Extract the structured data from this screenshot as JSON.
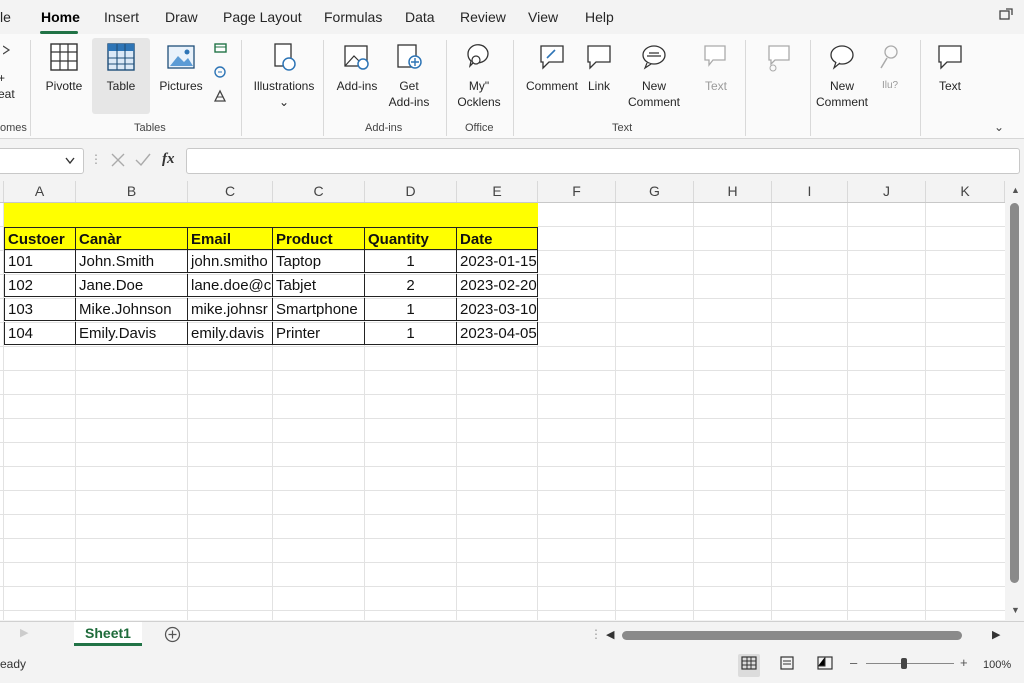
{
  "menu": {
    "file_partial": "le",
    "items": [
      "Home",
      "Insert",
      "Draw",
      "Page Layout",
      "Formulas",
      "Data",
      "Review",
      "View",
      "Help"
    ]
  },
  "ribbon": {
    "left_partial_1": "+",
    "left_partial_2": "eat",
    "left_group_partial": "omes",
    "pivot_label": "Pivotte",
    "table_label": "Table",
    "pictures_label": "Pictures",
    "tables_group": "Tables",
    "illustrations_label": "Illustrations",
    "addins_label": "Add-ins",
    "get_addins_label_1": "Get",
    "get_addins_label_2": "Add-ins",
    "addins_group": "Add-ins",
    "myoffice_label_1": "My\"",
    "myoffice_label_2": "Ocklens",
    "office_group": "Office",
    "comment_label": "Comment",
    "link_label": "Link",
    "new_comment_label_1": "New",
    "new_comment_label_2": "Comment",
    "text_dim_label": "Text",
    "text_group": "Text",
    "new_comment2_label_1": "New",
    "new_comment2_label_2": "Comment",
    "small_dim_label": "Ilu?",
    "text_label": "Text"
  },
  "formula_bar": {
    "fx": "fx",
    "value": ""
  },
  "columns": [
    "A",
    "B",
    "C",
    "C",
    "D",
    "E",
    "F",
    "G",
    "H",
    "I",
    "J",
    "K"
  ],
  "sheet": {
    "headers": [
      "Custoer",
      "Canàr",
      "Email",
      "Product",
      "Quantity",
      "Date"
    ],
    "rows": [
      [
        "101",
        "John.Smith",
        "john.smitho",
        "Taptop",
        "1",
        "2023-01-15"
      ],
      [
        "102",
        "Jane.Doe",
        "lane.doe@c",
        "Tabjet",
        "2",
        "2023-02-20"
      ],
      [
        "103",
        "Mike.Johnson",
        "mike.johnsr",
        "Smartphone",
        "1",
        "2023-03-10"
      ],
      [
        "104",
        "Emily.Davis",
        "emily.davis",
        "Printer",
        "1",
        "2023-04-05"
      ]
    ]
  },
  "tabs": {
    "sheet1": "Sheet1"
  },
  "status": {
    "ready_partial": "eady",
    "zoom": "100%"
  },
  "colors": {
    "accent": "#217346",
    "highlight": "#ffff00"
  }
}
